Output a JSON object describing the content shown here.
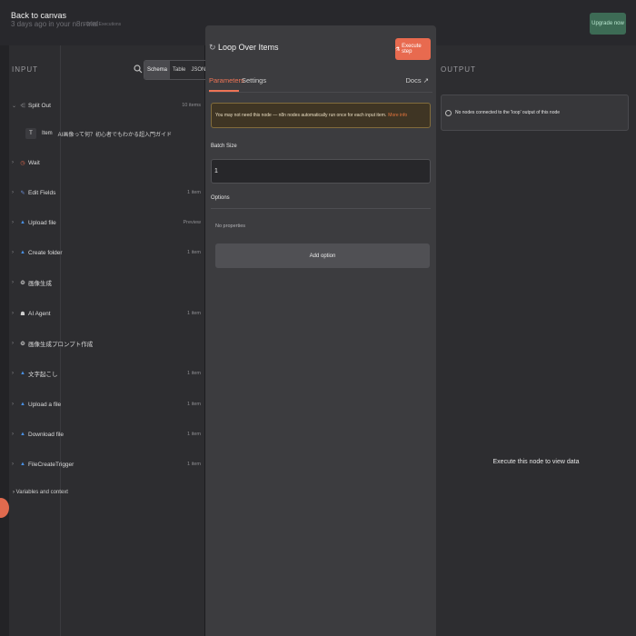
{
  "window": {
    "back_label": "Back to canvas",
    "bg_faded_text": "3 days ago in your n8n trial",
    "bg_faded_text2": "2/1000 Executions",
    "upgrade_label": "Upgrade now"
  },
  "input": {
    "title": "INPUT",
    "view_modes": [
      "Schema",
      "Table",
      "JSON"
    ],
    "active_view": "Schema",
    "nodes": [
      {
        "label": "Split Out",
        "count": "10 items",
        "icon": "split-icon",
        "color": "#8e8e92"
      },
      {
        "label": "Wait",
        "count": "",
        "icon": "wait-icon",
        "color": "#e06a4e"
      },
      {
        "label": "Edit Fields",
        "count": "1 item",
        "icon": "pencil-icon",
        "color": "#6b8fd6"
      },
      {
        "label": "Upload file",
        "count": "Preview",
        "icon": "gdrive-icon",
        "color": "#4a90e2"
      },
      {
        "label": "Create folder",
        "count": "1 item",
        "icon": "gdrive-icon",
        "color": "#4a90e2"
      },
      {
        "label": "画像生成",
        "count": "",
        "icon": "openai-icon",
        "color": "#cfcfcf"
      },
      {
        "label": "AI Agent",
        "count": "1 item",
        "icon": "robot-icon",
        "color": "#cfcfcf"
      },
      {
        "label": "画像生成プロンプト作成",
        "count": "",
        "icon": "openai-icon",
        "color": "#cfcfcf"
      },
      {
        "label": "文字起こし",
        "count": "1 item",
        "icon": "gdrive-icon",
        "color": "#4a90e2"
      },
      {
        "label": "Upload a file",
        "count": "1 item",
        "icon": "gdrive-icon",
        "color": "#4a90e2"
      },
      {
        "label": "Download file",
        "count": "1 item",
        "icon": "gdrive-icon",
        "color": "#4a90e2"
      },
      {
        "label": "FileCreateTrigger",
        "count": "1 item",
        "icon": "gdrive-icon",
        "color": "#4a90e2"
      }
    ],
    "sub_item": {
      "key": "Item",
      "type_icon": "T",
      "value": "AI画像って何？初心者でもわかる超入門ガイド"
    },
    "variables_label": "Variables and context"
  },
  "main": {
    "title": "Loop Over Items",
    "execute_label": "Execute step",
    "tabs": [
      "Parameters",
      "Settings"
    ],
    "active_tab": "Parameters",
    "docs_label": "Docs",
    "warning_text": "You may not need this node — n8n nodes automatically run once for each input item.",
    "warning_link": "More info",
    "batch_size_label": "Batch Size",
    "batch_size_value": "1",
    "options_label": "Options",
    "no_properties": "No properties",
    "add_option_label": "Add option"
  },
  "output": {
    "title": "OUTPUT",
    "notice": "No nodes connected to the 'loop' output of this node",
    "execute_hint": "Execute this node to view data"
  },
  "colors": {
    "accent": "#ee7456",
    "execute_button": "#e86a4f",
    "warning_bg": "#3f3524"
  }
}
